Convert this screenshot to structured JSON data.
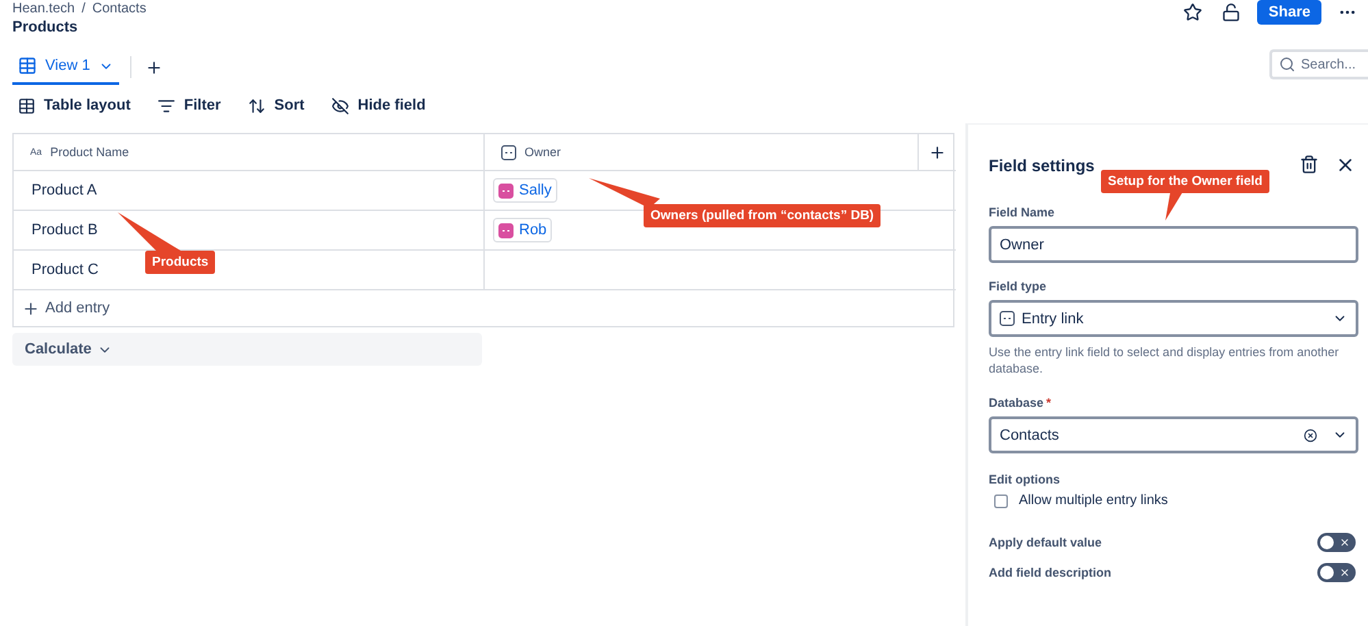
{
  "breadcrumb": [
    "Hean.tech",
    "Contacts"
  ],
  "breadcrumb_separator": "/",
  "page_title": "Products",
  "header_actions": {
    "starred": false,
    "share": "Share"
  },
  "view_tabs": [
    {
      "label": "View 1",
      "selected": true
    }
  ],
  "search": {
    "placeholder": "Search..."
  },
  "toolbar": [
    "Table layout",
    "Filter",
    "Sort",
    "Hide field"
  ],
  "table": {
    "columns": [
      "Product Name",
      "Owner"
    ],
    "text_type_icon": "Aa",
    "rows": [
      {
        "name": "Product A",
        "owner": "Sally"
      },
      {
        "name": "Product B",
        "owner": "Rob"
      },
      {
        "name": "Product C"
      }
    ],
    "add_entry": "Add entry"
  },
  "calculate": "Calculate",
  "annotations": [
    {
      "text": "Products"
    },
    {
      "text": "Owners (pulled from “contacts” DB)"
    },
    {
      "text": "Setup for the Owner field"
    }
  ],
  "field_settings": {
    "title": "Field settings",
    "field_name": {
      "label": "Field Name",
      "value": "Owner"
    },
    "field_type": {
      "label": "Field type",
      "value": "Entry link",
      "help": "Use the entry link field to select and display entries from another database."
    },
    "database": {
      "label": "Database",
      "required_mark": "*",
      "value": "Contacts"
    },
    "edit_options": {
      "label": "Edit options",
      "options": [
        {
          "label": "Allow multiple entry links",
          "checked": false
        }
      ]
    },
    "toggles": [
      {
        "label": "Apply default value",
        "on": false
      },
      {
        "label": "Add field description",
        "on": false
      }
    ]
  }
}
